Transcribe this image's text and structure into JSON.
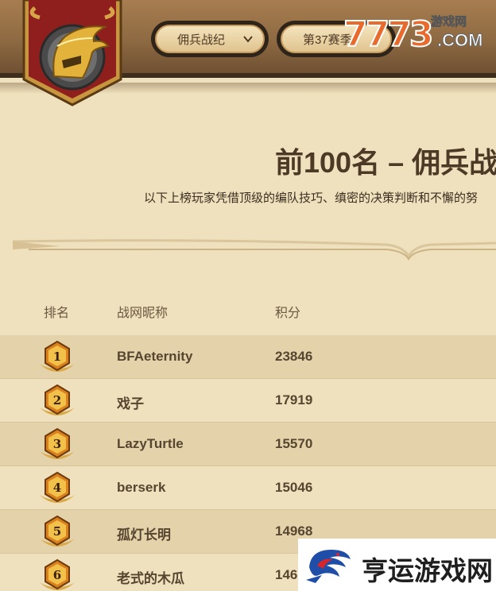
{
  "header": {
    "mode_dropdown": "佣兵战纪",
    "season_dropdown": "第37赛季",
    "watermark_number": "7773",
    "watermark_site": "游戏网",
    "watermark_com": ".COM"
  },
  "main": {
    "title": "前100名 – 佣兵战",
    "subtitle": "以下上榜玩家凭借顶级的编队技巧、缜密的决策判断和不懈的努"
  },
  "table": {
    "headers": {
      "rank": "排名",
      "name": "战网昵称",
      "score": "积分"
    },
    "rows": [
      {
        "rank": "1",
        "name": "BFAeternity",
        "score": "23846"
      },
      {
        "rank": "2",
        "name": "戏子",
        "score": "17919"
      },
      {
        "rank": "3",
        "name": "LazyTurtle",
        "score": "15570"
      },
      {
        "rank": "4",
        "name": "berserk",
        "score": "15046"
      },
      {
        "rank": "5",
        "name": "孤灯长明",
        "score": "14968"
      },
      {
        "rank": "6",
        "name": "老式的木瓜",
        "score": "146"
      }
    ]
  },
  "footer_watermark": {
    "text": "亨运游戏网"
  },
  "colors": {
    "page_bg": "#efe1bd",
    "row_dark": "#e4d3aa",
    "text_brown": "#574530",
    "banner_red": "#8e1f1c",
    "badge_orange": "#d9801f"
  },
  "icons": {
    "emblem": "golden-helmet-icon",
    "dropdown_arrow": "chevron-down-icon",
    "rank_badge": "rank-laurel-badge-icon",
    "footer_logo": "dragon-logo-icon"
  }
}
